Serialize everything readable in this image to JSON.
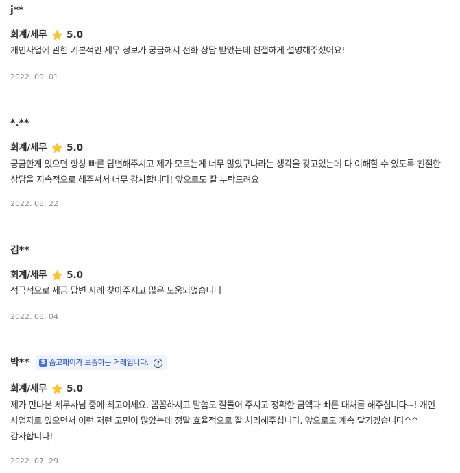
{
  "colors": {
    "text": "#323232",
    "date": "#8c8c8c",
    "star": "#ffc32b",
    "badge_bg": "#eef3ff",
    "badge_text": "#1f4fc6"
  },
  "reviews": [
    {
      "author": "j**",
      "category": "회계/세무",
      "rating": "5.0",
      "content": "개인사업에 관한 기본적인 세무 정보가 궁금해서 전화 상담 받았는데 친절하게 설명해주셨어요!",
      "date": "2022. 09. 01"
    },
    {
      "author": "*.**",
      "category": "회계/세무",
      "rating": "5.0",
      "content": "궁금한게 있으면 항상 빠른 답변해주시고 제가 모르는게 너무 많았구나라는 생각을 갖고있는데 다 이해할 수 있도록 친절한 상담을 지속적으로 해주셔서 너무 감사합니다! 앞으로도 잘 부탁드려요",
      "date": "2022. 08. 22"
    },
    {
      "author": "김**",
      "category": "회계/세무",
      "rating": "5.0",
      "content": "적극적으로 세금 답변 사례 찾아주시고 많은 도움되었습니다",
      "date": "2022. 08. 04"
    },
    {
      "author": "박**",
      "badge": {
        "icon": "soomgo-pay-icon",
        "text": "숨고페이가 보증하는 거래입니다."
      },
      "category": "회계/세무",
      "rating": "5.0",
      "content": "제가 만나본 세무사님 중에 최고이세요. 꼼꼼하시고 말씀도 잘들어 주시고 정확한 금액과 빠른 대처를 해주십니다~! 개인 사업자로 있으면서 이런 저런 고민이 많았는데 정말 효율적으로 잘 처리해주십니다. 앞으로도 계속 맡기겠습니다^^ 감사합니다!",
      "date": "2022. 07. 29"
    }
  ]
}
